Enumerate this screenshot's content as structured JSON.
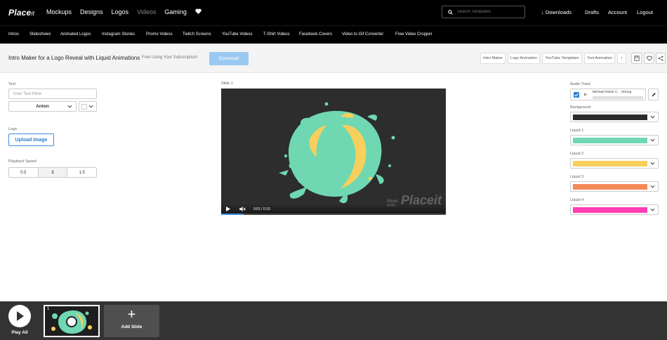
{
  "brand": {
    "logo_main": "Place",
    "logo_suffix": "it"
  },
  "top_nav": {
    "items": [
      "Mockups",
      "Designs",
      "Logos",
      "Videos",
      "Gaming"
    ]
  },
  "search": {
    "placeholder": "Search Templates"
  },
  "right_nav": {
    "downloads": "Downloads",
    "drafts": "Drafts",
    "account": "Account",
    "logout": "Logout"
  },
  "sub_nav": {
    "items": [
      "Intros",
      "Slideshows",
      "Animated Logos",
      "Instagram Stories",
      "Promo Videos",
      "Twitch Screens",
      "YouTube Videos",
      "T-Shirt Videos",
      "Facebook Covers",
      "Video to Gif Converter",
      "Free Video Cropper"
    ]
  },
  "title_bar": {
    "title": "Intro Maker for a Logo Reveal with Liquid Animations",
    "subtitle": "Free Using Your Subscription!",
    "download_label": "Download",
    "tags": [
      "Intro Maker",
      "Logo Animation",
      "YouTube Templates",
      "Text Animation"
    ],
    "more_tag": "•"
  },
  "left_panel": {
    "text_label": "Text",
    "text_placeholder": "User Text Here",
    "font_value": "Anton",
    "logo_label": "Logo",
    "upload_label": "Upload Image",
    "speed_label": "Playback Speed",
    "speed_options": [
      "0.5",
      "1",
      "1.5"
    ],
    "speed_selected": "1"
  },
  "video": {
    "slide_label": "Slide 1",
    "timecode": "0:01 / 0:10",
    "progress": 0.1,
    "watermark_small_1": "Made",
    "watermark_small_2": "with",
    "watermark_big": "Placeit"
  },
  "right_panel": {
    "audio_label": "Audio Track",
    "audio_track": "Michael Ramir C. - Strong",
    "audio_checked": true,
    "colors": [
      {
        "label": "Background",
        "hex": "#2b2b2b"
      },
      {
        "label": "Liquid 1",
        "hex": "#6fd8b2"
      },
      {
        "label": "Liquid 2",
        "hex": "#f7cf5c"
      },
      {
        "label": "Liquid 3",
        "hex": "#f5895a"
      },
      {
        "label": "Liquid 4",
        "hex": "#ff3db4"
      }
    ]
  },
  "bottom_bar": {
    "play_all_label": "Play All",
    "slide_number": "1",
    "add_slide_label": "Add Slide",
    "add_icon": "+"
  }
}
